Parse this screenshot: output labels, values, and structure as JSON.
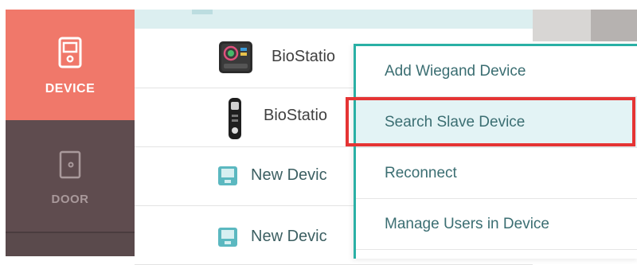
{
  "nav": {
    "items": [
      {
        "label": "DEVICE",
        "icon": "device-icon",
        "active": true
      },
      {
        "label": "DOOR",
        "icon": "door-icon",
        "active": false
      }
    ]
  },
  "device_list": {
    "rows": [
      {
        "label": "BioStatio",
        "icon": "biostation-device-icon"
      },
      {
        "label": "BioStatio",
        "icon": "biostation-slim-device-icon"
      },
      {
        "label": "New Devic",
        "icon": "generic-device-icon"
      },
      {
        "label": "New Devic",
        "icon": "generic-device-icon"
      }
    ]
  },
  "context_menu": {
    "items": [
      {
        "label": "Add Wiegand Device"
      },
      {
        "label": "Search Slave Device",
        "highlighted": true
      },
      {
        "label": "Reconnect"
      },
      {
        "label": "Manage Users in Device"
      }
    ]
  },
  "colors": {
    "accent": "#2ab0a5",
    "nav_active": "#f0786a",
    "nav_inactive": "#5f4c4f",
    "highlight_box": "#e53434"
  }
}
